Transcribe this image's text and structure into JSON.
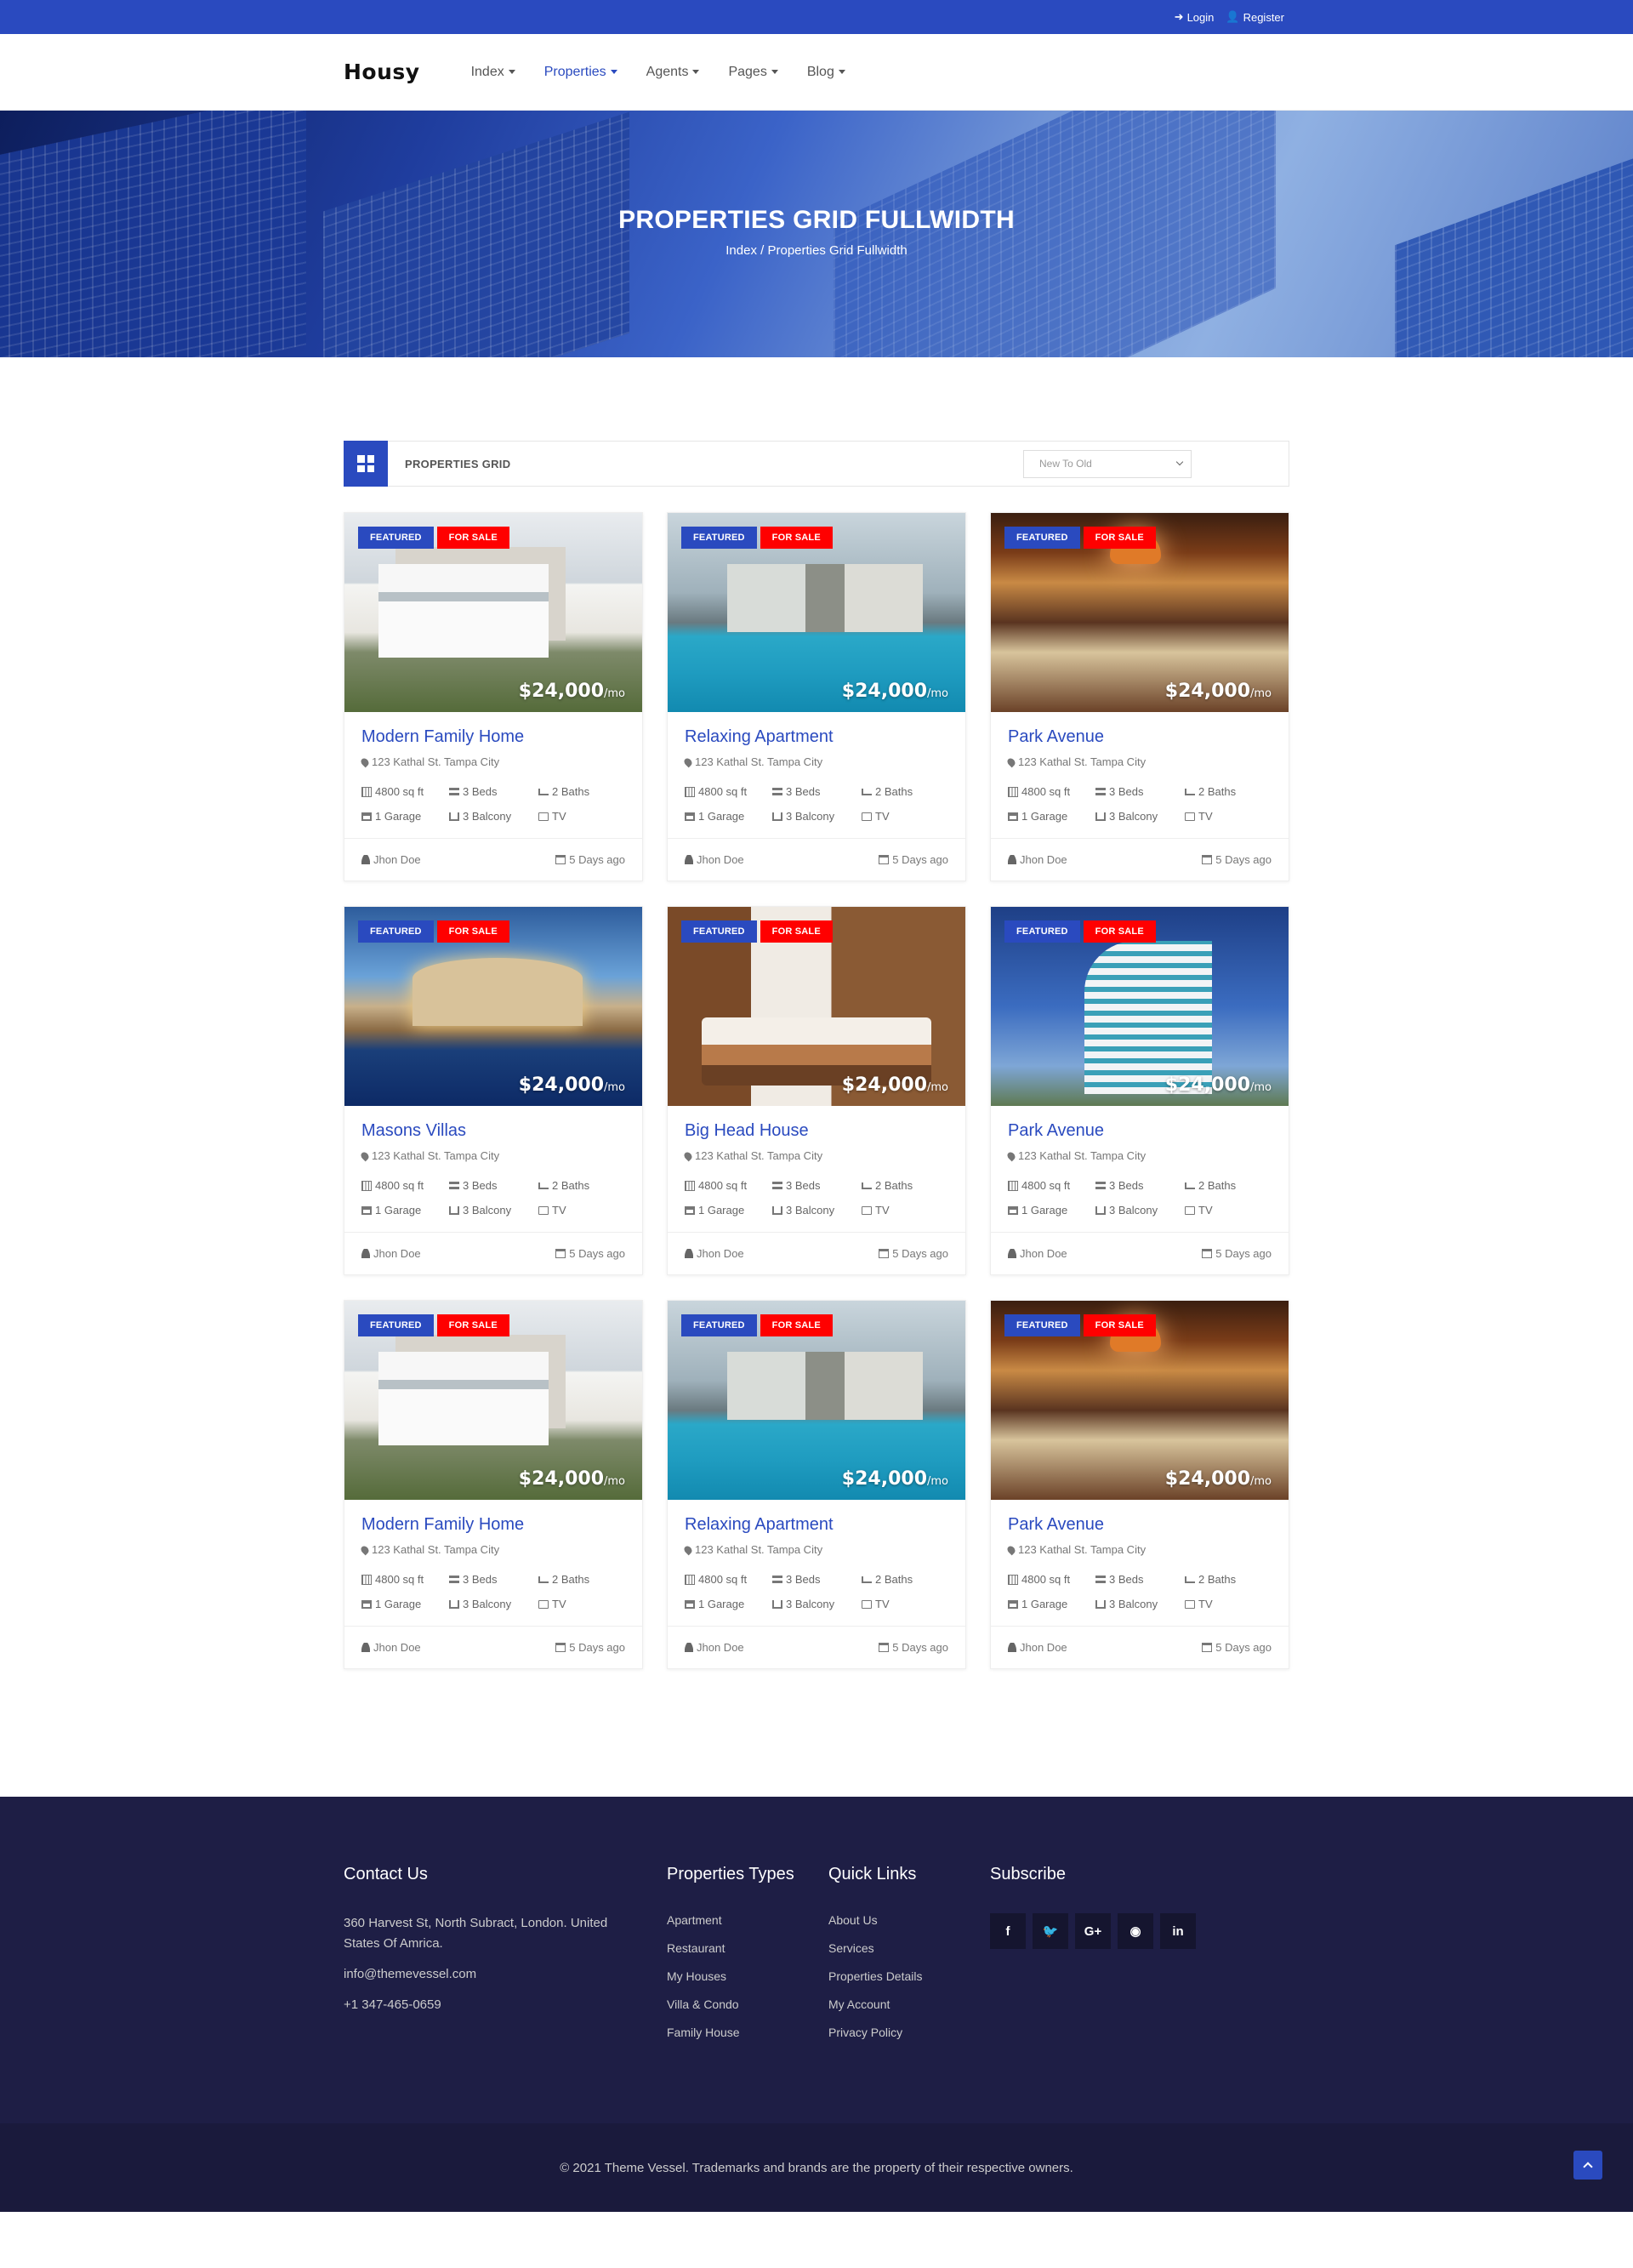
{
  "topbar": {
    "login": "Login",
    "register": "Register"
  },
  "nav": {
    "logo": "Housy",
    "items": [
      {
        "label": "Index"
      },
      {
        "label": "Properties"
      },
      {
        "label": "Agents"
      },
      {
        "label": "Pages"
      },
      {
        "label": "Blog"
      }
    ]
  },
  "hero": {
    "title": "Properties Grid Fullwidth",
    "breadcrumb_home": "Index",
    "breadcrumb_sep": "/",
    "breadcrumb_current": "Properties Grid Fullwidth"
  },
  "options": {
    "title": "PROPERTIES GRID",
    "sort": "New To Old"
  },
  "card_common": {
    "badge_featured": "FEATURED",
    "badge_sale": "FOR SALE",
    "price": "$24,000",
    "per": "/mo",
    "address": "123 Kathal St. Tampa City",
    "area": "4800 sq ft",
    "beds": "3 Beds",
    "baths": "2 Baths",
    "garage": "1 Garage",
    "balcony": "3 Balcony",
    "tv": "TV",
    "agent": "Jhon Doe",
    "date": "5 Days ago"
  },
  "cards": [
    {
      "title": "Modern Family Home",
      "image": "img-house"
    },
    {
      "title": "Relaxing Apartment",
      "image": "img-pool"
    },
    {
      "title": "Park Avenue",
      "image": "img-lobby"
    },
    {
      "title": "Masons Villas",
      "image": "img-villa"
    },
    {
      "title": "Big Head House",
      "image": "img-bed"
    },
    {
      "title": "Park Avenue",
      "image": "img-hotel"
    },
    {
      "title": "Modern Family Home",
      "image": "img-house"
    },
    {
      "title": "Relaxing Apartment",
      "image": "img-pool"
    },
    {
      "title": "Park Avenue",
      "image": "img-lobby"
    }
  ],
  "footer": {
    "contact": {
      "title": "Contact Us",
      "address": "360 Harvest St, North Subract, London. United States Of Amrica.",
      "email": "info@themevessel.com",
      "phone": "+1 347-465-0659"
    },
    "types": {
      "title": "Properties Types",
      "items": [
        "Apartment",
        "Restaurant",
        "My Houses",
        "Villa & Condo",
        "Family House"
      ]
    },
    "links": {
      "title": "Quick Links",
      "items": [
        "About Us",
        "Services",
        "Properties Details",
        "My Account",
        "Privacy Policy"
      ]
    },
    "subscribe": {
      "title": "Subscribe",
      "social": [
        "f",
        "t",
        "G+",
        "rss",
        "in"
      ]
    },
    "copyright": "© 2021 Theme Vessel. Trademarks and brands are the property of their respective owners."
  },
  "colors": {
    "primary": "#2a4abf",
    "sale": "#ff0000",
    "footer": "#1e1e45"
  }
}
